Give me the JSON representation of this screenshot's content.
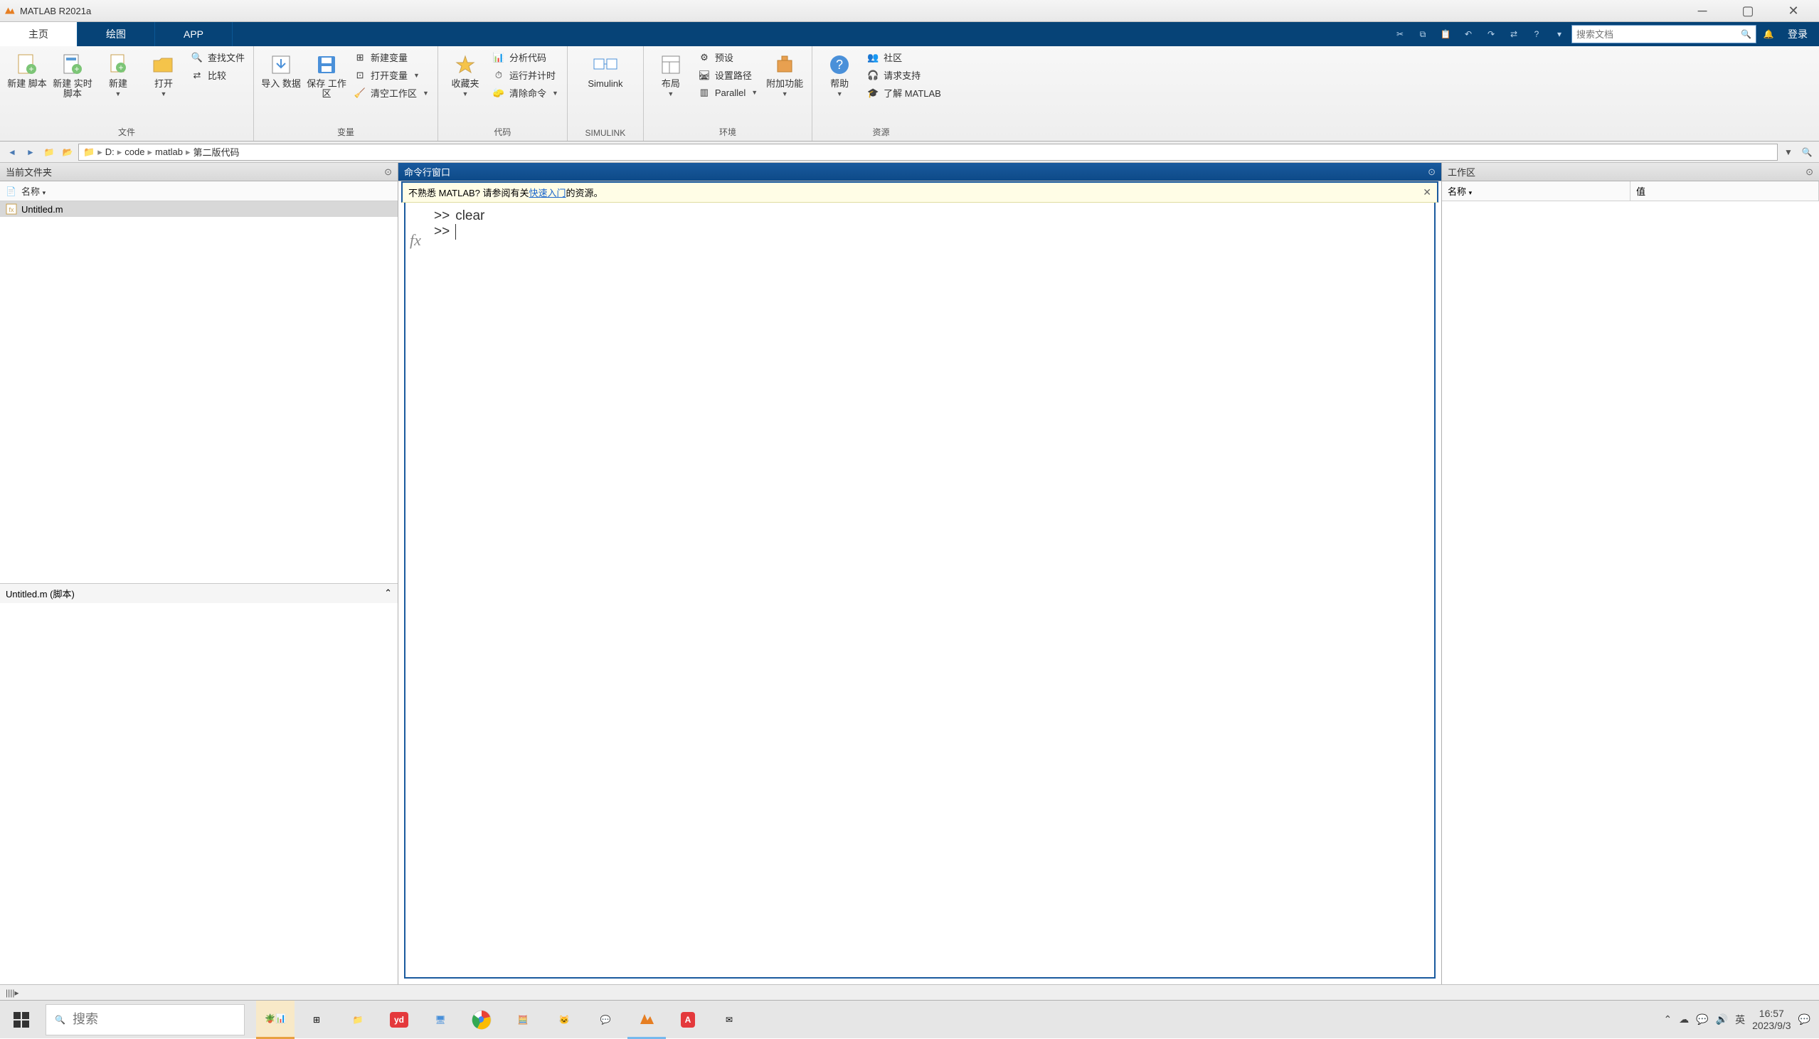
{
  "title_bar": {
    "title": "MATLAB R2021a"
  },
  "tabs": {
    "home": "主页",
    "plots": "绘图",
    "apps": "APP"
  },
  "search": {
    "placeholder": "搜索文档"
  },
  "login": "登录",
  "ribbon": {
    "file_group": "文件",
    "new_script": "新建\n脚本",
    "new_live": "新建\n实时脚本",
    "new": "新建",
    "open": "打开",
    "find_files": "查找文件",
    "compare": "比较",
    "var_group": "变量",
    "import": "导入\n数据",
    "save_ws": "保存\n工作区",
    "new_var": "新建变量",
    "open_var": "打开变量",
    "clear_ws": "清空工作区",
    "code_group": "代码",
    "favorites": "收藏夹",
    "analyze": "分析代码",
    "run_time": "运行并计时",
    "clear_cmd": "清除命令",
    "simulink_group": "SIMULINK",
    "simulink": "Simulink",
    "env_group": "环境",
    "layout": "布局",
    "prefs": "预设",
    "set_path": "设置路径",
    "parallel": "Parallel",
    "addons": "附加功能",
    "res_group": "资源",
    "help": "帮助",
    "community": "社区",
    "support": "请求支持",
    "learn": "了解 MATLAB"
  },
  "address": {
    "drive": "D:",
    "p1": "code",
    "p2": "matlab",
    "p3": "第二版代码"
  },
  "panels": {
    "current_folder": "当前文件夹",
    "command_window": "命令行窗口",
    "workspace": "工作区",
    "name_col": "名称",
    "value_col": "值"
  },
  "files": {
    "selected": "Untitled.m",
    "details": "Untitled.m  (脚本)"
  },
  "cmd": {
    "banner_pre": "不熟悉 MATLAB? 请参阅有关",
    "banner_link": "快速入门",
    "banner_post": "的资源。",
    "line1": "clear",
    "prompt": ">>"
  },
  "taskbar": {
    "search_placeholder": "搜索",
    "ime": "英",
    "time": "16:57",
    "date": "2023/9/3"
  }
}
